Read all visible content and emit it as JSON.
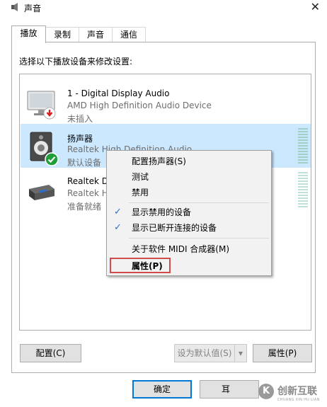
{
  "window": {
    "title": "声音",
    "close_glyph": "✕"
  },
  "tabs": [
    {
      "label": "播放",
      "active": true
    },
    {
      "label": "录制",
      "active": false
    },
    {
      "label": "声音",
      "active": false
    },
    {
      "label": "通信",
      "active": false
    }
  ],
  "instruction": "选择以下播放设备来修改设置:",
  "devices": [
    {
      "name": "1 - Digital Display Audio",
      "desc": "AMD High Definition Audio Device",
      "status": "未插入",
      "icon": "monitor-icon",
      "badge": "unplugged-badge-icon",
      "selected": false
    },
    {
      "name": "扬声器",
      "desc": "Realtek High Definition Audio",
      "status": "默认设备",
      "icon": "speaker-icon",
      "badge": "default-check-badge-icon",
      "selected": true
    },
    {
      "name": "Realtek D",
      "desc": "Realtek H",
      "status": "准备就绪",
      "icon": "digital-output-icon",
      "badge": "",
      "selected": false
    }
  ],
  "context_menu": {
    "items": [
      {
        "label": "配置扬声器(S)",
        "checked": false
      },
      {
        "label": "测试",
        "checked": false
      },
      {
        "label": "禁用",
        "checked": false
      },
      {
        "label": "显示禁用的设备",
        "checked": true
      },
      {
        "label": "显示已断开连接的设备",
        "checked": true
      },
      {
        "label": "关于软件 MIDI 合成器(M)",
        "checked": false
      },
      {
        "label": "属性(P)",
        "checked": false,
        "highlighted": true
      }
    ],
    "check_glyph": "✓"
  },
  "buttons": {
    "configure": "配置(C)",
    "set_default": "设为默认值(S)",
    "set_default_arrow": "▾",
    "properties": "属性(P)",
    "ok": "确定",
    "cancel_partial": "耳"
  },
  "watermark": {
    "logo_glyph": "K",
    "text": "创新互联",
    "subtext": "CHUANG XIN HU LIAN"
  },
  "colors": {
    "selection": "#cce8ff",
    "accent": "#0078d7",
    "highlight_box": "#d24b4b",
    "check": "#2b6cd1"
  }
}
